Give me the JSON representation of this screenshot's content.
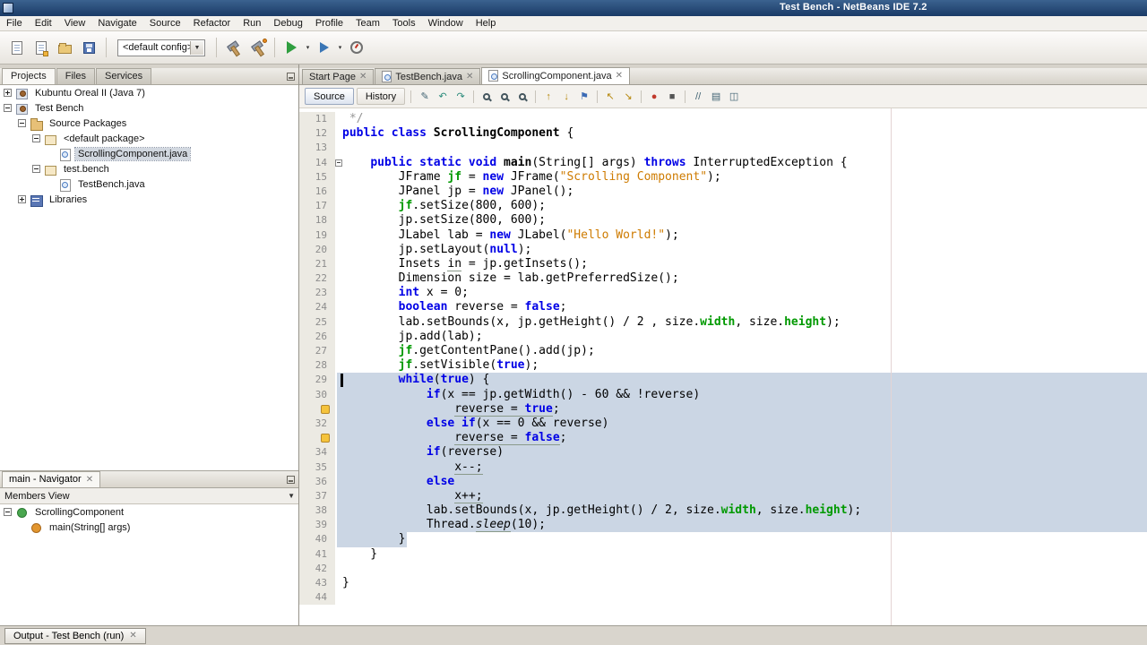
{
  "window": {
    "title": "Test Bench - NetBeans IDE 7.2"
  },
  "menubar": [
    "File",
    "Edit",
    "View",
    "Navigate",
    "Source",
    "Refactor",
    "Run",
    "Debug",
    "Profile",
    "Team",
    "Tools",
    "Window",
    "Help"
  ],
  "toolbar": {
    "config_value": "<default config>",
    "file_icons": [
      "new-file-icon",
      "new-project-icon",
      "open-project-icon",
      "save-all-icon"
    ],
    "build_icons": [
      "build-project-icon",
      "clean-build-project-icon"
    ],
    "run_icons": [
      "run-project-icon",
      "debug-project-icon",
      "profile-project-icon"
    ]
  },
  "projects_panel": {
    "tabs": [
      {
        "label": "Projects",
        "active": true
      },
      {
        "label": "Files",
        "active": false
      },
      {
        "label": "Services",
        "active": false
      }
    ],
    "tree": [
      {
        "label": "Kubuntu Oreal II (Java 7)",
        "indent": 0,
        "expander": "+",
        "icon": "project-icon"
      },
      {
        "label": "Test Bench",
        "indent": 0,
        "expander": "-",
        "icon": "project-icon"
      },
      {
        "label": "Source Packages",
        "indent": 1,
        "expander": "-",
        "icon": "source-folder-icon"
      },
      {
        "label": "<default package>",
        "indent": 2,
        "expander": "-",
        "icon": "package-icon"
      },
      {
        "label": "ScrollingComponent.java",
        "indent": 3,
        "expander": "",
        "icon": "java-file-icon",
        "selected": true
      },
      {
        "label": "test.bench",
        "indent": 2,
        "expander": "-",
        "icon": "package-icon"
      },
      {
        "label": "TestBench.java",
        "indent": 3,
        "expander": "",
        "icon": "java-file-icon"
      },
      {
        "label": "Libraries",
        "indent": 1,
        "expander": "+",
        "icon": "libraries-icon"
      }
    ]
  },
  "navigator_panel": {
    "title": "main - Navigator",
    "view_selector": "Members View",
    "tree": [
      {
        "label": "ScrollingComponent",
        "indent": 0,
        "expander": "-",
        "icon": "class-icon"
      },
      {
        "label": "main(String[] args)",
        "indent": 1,
        "expander": "",
        "icon": "static-method-icon"
      }
    ]
  },
  "editor": {
    "tabs": [
      {
        "label": "Start Page",
        "icon": false,
        "active": false
      },
      {
        "label": "TestBench.java",
        "icon": true,
        "active": false
      },
      {
        "label": "ScrollingComponent.java",
        "icon": true,
        "active": true
      }
    ],
    "toolbar": {
      "source_label": "Source",
      "history_label": "History",
      "icons": [
        {
          "name": "last-edit-icon",
          "glyph": "✎"
        },
        {
          "name": "back-icon",
          "glyph": "↶",
          "color": "#2a8a7a"
        },
        {
          "name": "forward-icon",
          "glyph": "↷",
          "color": "#2a8a7a"
        },
        {
          "name": "sep"
        },
        {
          "name": "find-selection-icon",
          "glyph": "mag"
        },
        {
          "name": "find-occurrences-icon",
          "glyph": "mag"
        },
        {
          "name": "toggle-highlight-search-icon",
          "glyph": "mag"
        },
        {
          "name": "sep"
        },
        {
          "name": "previous-bookmark-icon",
          "glyph": "↑",
          "color": "#b5860a"
        },
        {
          "name": "next-bookmark-icon",
          "glyph": "↓",
          "color": "#b5860a"
        },
        {
          "name": "toggle-bookmark-icon",
          "glyph": "⚑",
          "color": "#3a6ab5"
        },
        {
          "name": "sep"
        },
        {
          "name": "shift-left-icon",
          "glyph": "↖",
          "color": "#b5860a"
        },
        {
          "name": "shift-right-icon",
          "glyph": "↘",
          "color": "#b5860a"
        },
        {
          "name": "sep"
        },
        {
          "name": "start-macro-recording-icon",
          "glyph": "●",
          "color": "#c0392b"
        },
        {
          "name": "stop-macro-recording-icon",
          "glyph": "■",
          "color": "#555555"
        },
        {
          "name": "sep"
        },
        {
          "name": "comment-icon",
          "glyph": "//"
        },
        {
          "name": "uncomment-icon",
          "glyph": "▤"
        },
        {
          "name": "diff-icon",
          "glyph": "◫"
        }
      ]
    },
    "code": {
      "lines": [
        {
          "n": 11,
          "t": [
            [
              "cmt",
              " */"
            ]
          ]
        },
        {
          "n": 12,
          "t": [
            [
              "kw",
              "public class"
            ],
            [
              "plain",
              " "
            ],
            [
              "decl",
              "ScrollingComponent"
            ],
            [
              "plain",
              " {"
            ]
          ]
        },
        {
          "n": 13,
          "t": []
        },
        {
          "n": 14,
          "fold": true,
          "t": [
            [
              "plain",
              "    "
            ],
            [
              "kw",
              "public static void"
            ],
            [
              "plain",
              " "
            ],
            [
              "decl",
              "main"
            ],
            [
              "plain",
              "(String[] args) "
            ],
            [
              "kw",
              "throws"
            ],
            [
              "plain",
              " InterruptedException {"
            ]
          ]
        },
        {
          "n": 15,
          "t": [
            [
              "plain",
              "        JFrame "
            ],
            [
              "field",
              "jf"
            ],
            [
              "plain",
              " = "
            ],
            [
              "kw",
              "new"
            ],
            [
              "plain",
              " JFrame("
            ],
            [
              "str",
              "\"Scrolling Component\""
            ],
            [
              "plain",
              ");"
            ]
          ]
        },
        {
          "n": 16,
          "t": [
            [
              "plain",
              "        JPanel jp = "
            ],
            [
              "kw",
              "new"
            ],
            [
              "plain",
              " JPanel();"
            ]
          ]
        },
        {
          "n": 17,
          "t": [
            [
              "plain",
              "        "
            ],
            [
              "field",
              "jf"
            ],
            [
              "plain",
              ".setSize(800, 600);"
            ]
          ]
        },
        {
          "n": 18,
          "t": [
            [
              "plain",
              "        jp.setSize(800, 600);"
            ]
          ]
        },
        {
          "n": 19,
          "t": [
            [
              "plain",
              "        JLabel lab = "
            ],
            [
              "kw",
              "new"
            ],
            [
              "plain",
              " JLabel("
            ],
            [
              "str",
              "\"Hello World!\""
            ],
            [
              "plain",
              ");"
            ]
          ]
        },
        {
          "n": 20,
          "t": [
            [
              "plain",
              "        jp.setLayout("
            ],
            [
              "kw",
              "null"
            ],
            [
              "plain",
              ");"
            ]
          ]
        },
        {
          "n": 21,
          "t": [
            [
              "plain",
              "        Insets "
            ],
            [
              "plain ul",
              "in"
            ],
            [
              "plain",
              " = jp.getInsets();"
            ]
          ]
        },
        {
          "n": 22,
          "t": [
            [
              "plain",
              "        Dimension size = lab.getPreferredSize();"
            ]
          ]
        },
        {
          "n": 23,
          "t": [
            [
              "plain",
              "        "
            ],
            [
              "kw",
              "int"
            ],
            [
              "plain",
              " x = 0;"
            ]
          ]
        },
        {
          "n": 24,
          "t": [
            [
              "plain",
              "        "
            ],
            [
              "kw",
              "boolean"
            ],
            [
              "plain",
              " reverse = "
            ],
            [
              "kw",
              "false"
            ],
            [
              "plain",
              ";"
            ]
          ]
        },
        {
          "n": 25,
          "t": [
            [
              "plain",
              "        lab.setBounds(x, jp.getHeight() / 2 , size."
            ],
            [
              "field",
              "width"
            ],
            [
              "plain",
              ", size."
            ],
            [
              "field",
              "height"
            ],
            [
              "plain",
              ");"
            ]
          ]
        },
        {
          "n": 26,
          "t": [
            [
              "plain",
              "        jp.add(lab);"
            ]
          ]
        },
        {
          "n": 27,
          "t": [
            [
              "plain",
              "        "
            ],
            [
              "field",
              "jf"
            ],
            [
              "plain",
              ".getContentPane().add(jp);"
            ]
          ]
        },
        {
          "n": 28,
          "t": [
            [
              "plain",
              "        "
            ],
            [
              "field",
              "jf"
            ],
            [
              "plain",
              ".setVisible("
            ],
            [
              "kw",
              "true"
            ],
            [
              "plain",
              ");"
            ]
          ]
        },
        {
          "n": 29,
          "sel": "full",
          "caret": true,
          "t": [
            [
              "plain",
              "        "
            ],
            [
              "kw",
              "while"
            ],
            [
              "plain",
              "("
            ],
            [
              "kw",
              "true"
            ],
            [
              "plain",
              ") {"
            ]
          ]
        },
        {
          "n": 30,
          "sel": "full",
          "t": [
            [
              "plain",
              "            "
            ],
            [
              "kw",
              "if"
            ],
            [
              "plain",
              "(x == jp.getWidth() - 60 && !reverse)"
            ]
          ]
        },
        {
          "n": 31,
          "sel": "full",
          "icon": "suggestion",
          "t": [
            [
              "plain",
              "                "
            ],
            [
              "plain ul",
              "reverse = "
            ],
            [
              "kw ul",
              "true"
            ],
            [
              "plain",
              ";"
            ]
          ]
        },
        {
          "n": 32,
          "sel": "full",
          "t": [
            [
              "plain",
              "            "
            ],
            [
              "kw",
              "else if"
            ],
            [
              "plain",
              "(x == 0 && reverse)"
            ]
          ]
        },
        {
          "n": 33,
          "sel": "full",
          "icon": "suggestion",
          "t": [
            [
              "plain",
              "                "
            ],
            [
              "plain ul",
              "reverse = "
            ],
            [
              "kw ul",
              "false"
            ],
            [
              "plain",
              ";"
            ]
          ]
        },
        {
          "n": 34,
          "sel": "full",
          "t": [
            [
              "plain",
              "            "
            ],
            [
              "kw",
              "if"
            ],
            [
              "plain",
              "(reverse)"
            ]
          ]
        },
        {
          "n": 35,
          "sel": "full",
          "t": [
            [
              "plain",
              "                "
            ],
            [
              "plain ul",
              "x--;"
            ]
          ]
        },
        {
          "n": 36,
          "sel": "full",
          "t": [
            [
              "plain",
              "            "
            ],
            [
              "kw",
              "else"
            ]
          ]
        },
        {
          "n": 37,
          "sel": "full",
          "t": [
            [
              "plain",
              "                "
            ],
            [
              "plain ul",
              "x++;"
            ]
          ]
        },
        {
          "n": 38,
          "sel": "full",
          "t": [
            [
              "plain",
              "            lab.setBounds(x, jp.getHeight() / 2, size."
            ],
            [
              "field",
              "width"
            ],
            [
              "plain",
              ", size."
            ],
            [
              "field",
              "height"
            ],
            [
              "plain",
              ");"
            ]
          ]
        },
        {
          "n": 39,
          "sel": "full",
          "t": [
            [
              "plain",
              "            Thread."
            ],
            [
              "static ul",
              "sleep"
            ],
            [
              "plain",
              "(10);"
            ]
          ]
        },
        {
          "n": 40,
          "sel": "part",
          "selw": 78,
          "t": [
            [
              "plain",
              "        }"
            ]
          ]
        },
        {
          "n": 41,
          "t": [
            [
              "plain",
              "    }"
            ]
          ]
        },
        {
          "n": 42,
          "t": []
        },
        {
          "n": 43,
          "t": [
            [
              "plain",
              "}"
            ]
          ]
        },
        {
          "n": 44,
          "t": []
        }
      ]
    }
  },
  "output_panel": {
    "tab": "Output - Test Bench (run)"
  }
}
